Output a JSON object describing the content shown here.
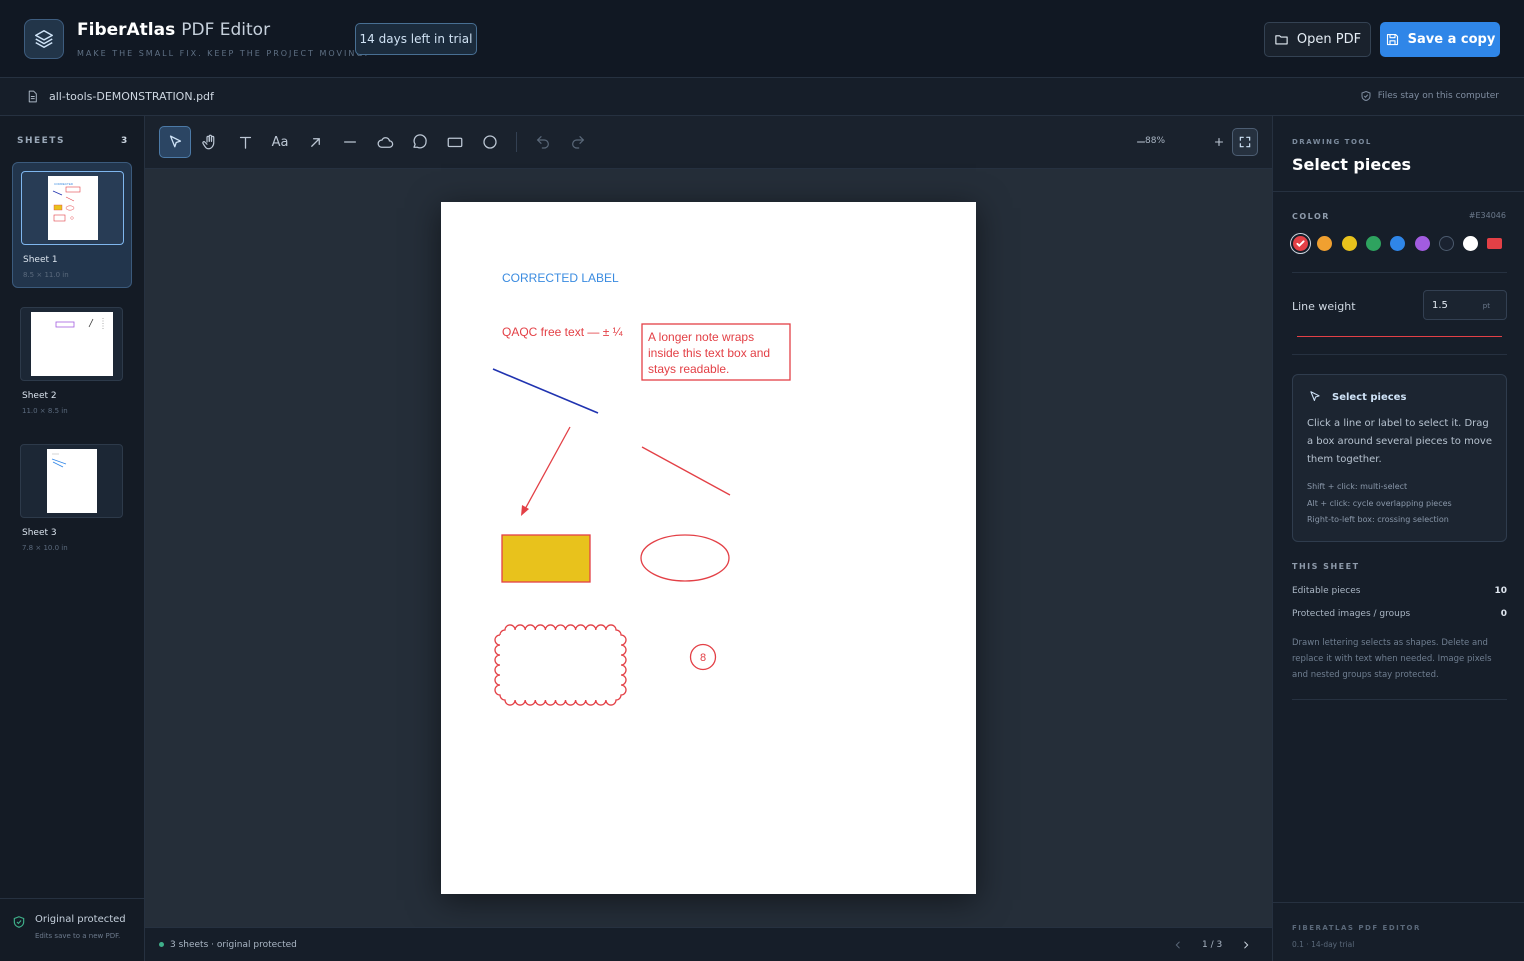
{
  "app": {
    "brand": "FiberAtlas",
    "product": "PDF Editor",
    "tagline": "MAKE THE SMALL FIX. KEEP THE PROJECT MOVING.",
    "trial_badge": "14 days left in trial",
    "open_label": "Open PDF",
    "save_label": "Save a copy"
  },
  "file": {
    "name": "all-tools-DEMONSTRATION.pdf",
    "privacy": "Files stay on this computer"
  },
  "sidebar": {
    "heading": "SHEETS",
    "count": "3",
    "sheets": [
      {
        "name": "Sheet 1",
        "dims": "8.5 × 11.0 in",
        "active": true
      },
      {
        "name": "Sheet 2",
        "dims": "11.0 × 8.5 in",
        "active": false
      },
      {
        "name": "Sheet 3",
        "dims": "7.8 × 10.0 in",
        "active": false
      }
    ],
    "protected_title": "Original protected",
    "protected_sub": "Edits save to a new PDF."
  },
  "toolbar": {
    "tools": [
      "select-icon",
      "hand-icon",
      "text-icon",
      "font-icon",
      "arrow-icon",
      "line-icon",
      "cloud-icon",
      "callout-icon",
      "rectangle-icon",
      "ellipse-icon"
    ],
    "active_tool": "select-icon",
    "zoom": "88%"
  },
  "document": {
    "corrected_label": "CORRECTED LABEL",
    "free_text": "QAQC free text — ± ¼",
    "note_lines": [
      "A longer note wraps",
      "inside this text box and",
      "stays readable."
    ],
    "stamp_number": "8"
  },
  "status": {
    "text": "3 sheets · original protected",
    "page": "1 / 3"
  },
  "panel": {
    "subheading": "DRAWING TOOL",
    "title": "Select pieces",
    "color_label": "COLOR",
    "color_hex": "#E34046",
    "swatches": [
      "#e34046",
      "#f0a030",
      "#e8c21c",
      "#2ea35f",
      "#2f86e8",
      "#a25ce0",
      "#1a2230",
      "#ffffff",
      "#e34046"
    ],
    "line_weight_label": "Line weight",
    "line_weight_value": "1.5",
    "line_weight_unit": "pt",
    "help_title": "Select pieces",
    "help_body": "Click a line or label to select it. Drag a box around several pieces to move them together.",
    "hints": [
      "Shift + click: multi-select",
      "Alt + click: cycle overlapping pieces",
      "Right-to-left box: crossing selection"
    ],
    "this_sheet_heading": "THIS SHEET",
    "editable_label": "Editable pieces",
    "editable_value": "10",
    "protected_label": "Protected images / groups",
    "protected_value": "0",
    "note": "Drawn lettering selects as shapes. Delete and replace it with text when needed. Image pixels and nested groups stay protected.",
    "footer_title": "FIBERATLAS PDF EDITOR",
    "footer_version": "0.1 · 14-day trial"
  }
}
